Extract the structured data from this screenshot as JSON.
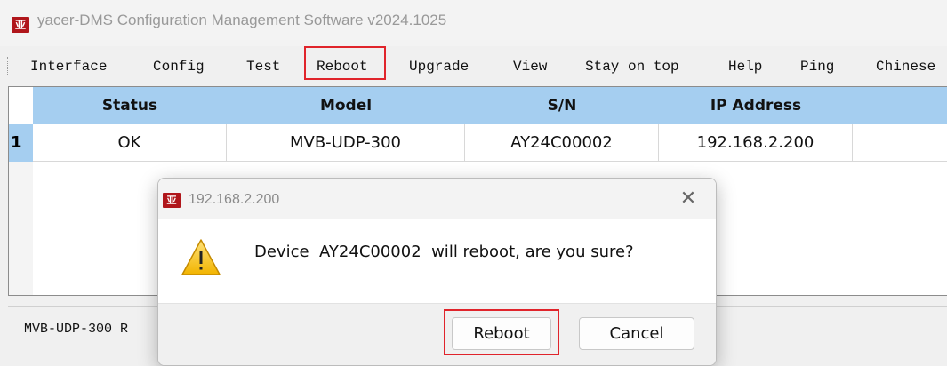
{
  "app": {
    "icon_glyph": "亚",
    "title": "yacer-DMS Configuration Management Software v2024.1025"
  },
  "menu": [
    "Interface",
    "Config",
    "Test",
    "Reboot",
    "Upgrade",
    "View",
    "Stay on top",
    "Help",
    "Ping",
    "Chinese"
  ],
  "highlight_color": "#e0242b",
  "table": {
    "header_color": "#a5cef0",
    "columns": [
      "Status",
      "Model",
      "S/N",
      "IP Address"
    ],
    "rows": [
      {
        "num": "1",
        "status": "OK",
        "model": "MVB-UDP-300",
        "sn": "AY24C00002",
        "ip": "192.168.2.200"
      }
    ]
  },
  "statusbar": {
    "text": "MVB-UDP-300 R"
  },
  "dialog": {
    "icon_glyph": "亚",
    "title": "192.168.2.200",
    "close_icon": "close-icon",
    "warning_icon": "warning-icon",
    "message": "Device  AY24C00002  will reboot, are you sure?",
    "confirm_label": "Reboot",
    "cancel_label": "Cancel"
  }
}
